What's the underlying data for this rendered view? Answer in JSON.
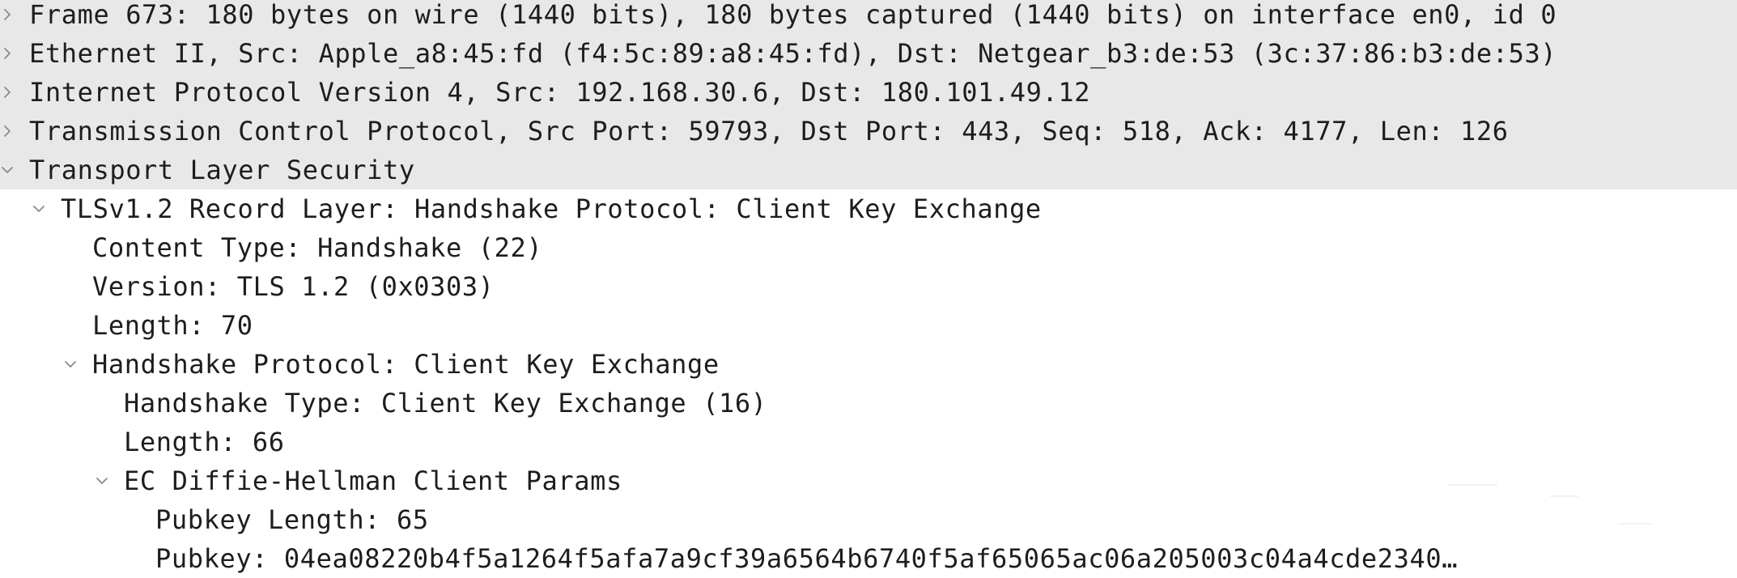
{
  "packet_details": {
    "rows": [
      {
        "text": "Frame 673: 180 bytes on wire (1440 bits), 180 bytes captured (1440 bits) on interface en0, id 0",
        "level": 0,
        "state": "collapsed",
        "top": true
      },
      {
        "text": "Ethernet II, Src: Apple_a8:45:fd (f4:5c:89:a8:45:fd), Dst: Netgear_b3:de:53 (3c:37:86:b3:de:53)",
        "level": 0,
        "state": "collapsed",
        "top": true
      },
      {
        "text": "Internet Protocol Version 4, Src: 192.168.30.6, Dst: 180.101.49.12",
        "level": 0,
        "state": "collapsed",
        "top": true
      },
      {
        "text": "Transmission Control Protocol, Src Port: 59793, Dst Port: 443, Seq: 518, Ack: 4177, Len: 126",
        "level": 0,
        "state": "collapsed",
        "top": true
      },
      {
        "text": "Transport Layer Security",
        "level": 0,
        "state": "expanded",
        "top": true
      },
      {
        "text": "TLSv1.2 Record Layer: Handshake Protocol: Client Key Exchange",
        "level": 1,
        "state": "expanded",
        "top": false
      },
      {
        "text": "Content Type: Handshake (22)",
        "level": 2,
        "state": "leaf",
        "top": false
      },
      {
        "text": "Version: TLS 1.2 (0x0303)",
        "level": 2,
        "state": "leaf",
        "top": false
      },
      {
        "text": "Length: 70",
        "level": 2,
        "state": "leaf",
        "top": false
      },
      {
        "text": "Handshake Protocol: Client Key Exchange",
        "level": 2,
        "state": "expanded",
        "top": false
      },
      {
        "text": "Handshake Type: Client Key Exchange (16)",
        "level": 3,
        "state": "leaf",
        "top": false
      },
      {
        "text": "Length: 66",
        "level": 3,
        "state": "leaf",
        "top": false
      },
      {
        "text": "EC Diffie-Hellman Client Params",
        "level": 3,
        "state": "expanded",
        "top": false
      },
      {
        "text": "Pubkey Length: 65",
        "level": 4,
        "state": "leaf",
        "top": false
      },
      {
        "text": "Pubkey: 04ea08220b4f5a1264f5afa7a9cf39a6564b6740f5af65065ac06a205003c04a4cde2340…",
        "level": 4,
        "state": "leaf",
        "top": false
      }
    ]
  },
  "icons": {
    "collapsed": "chevron-right-icon",
    "expanded": "chevron-down-icon"
  },
  "colors": {
    "top_level_background": "#e8e8e8",
    "text": "#1d1d1d",
    "chevron": "#8a8a8a"
  }
}
